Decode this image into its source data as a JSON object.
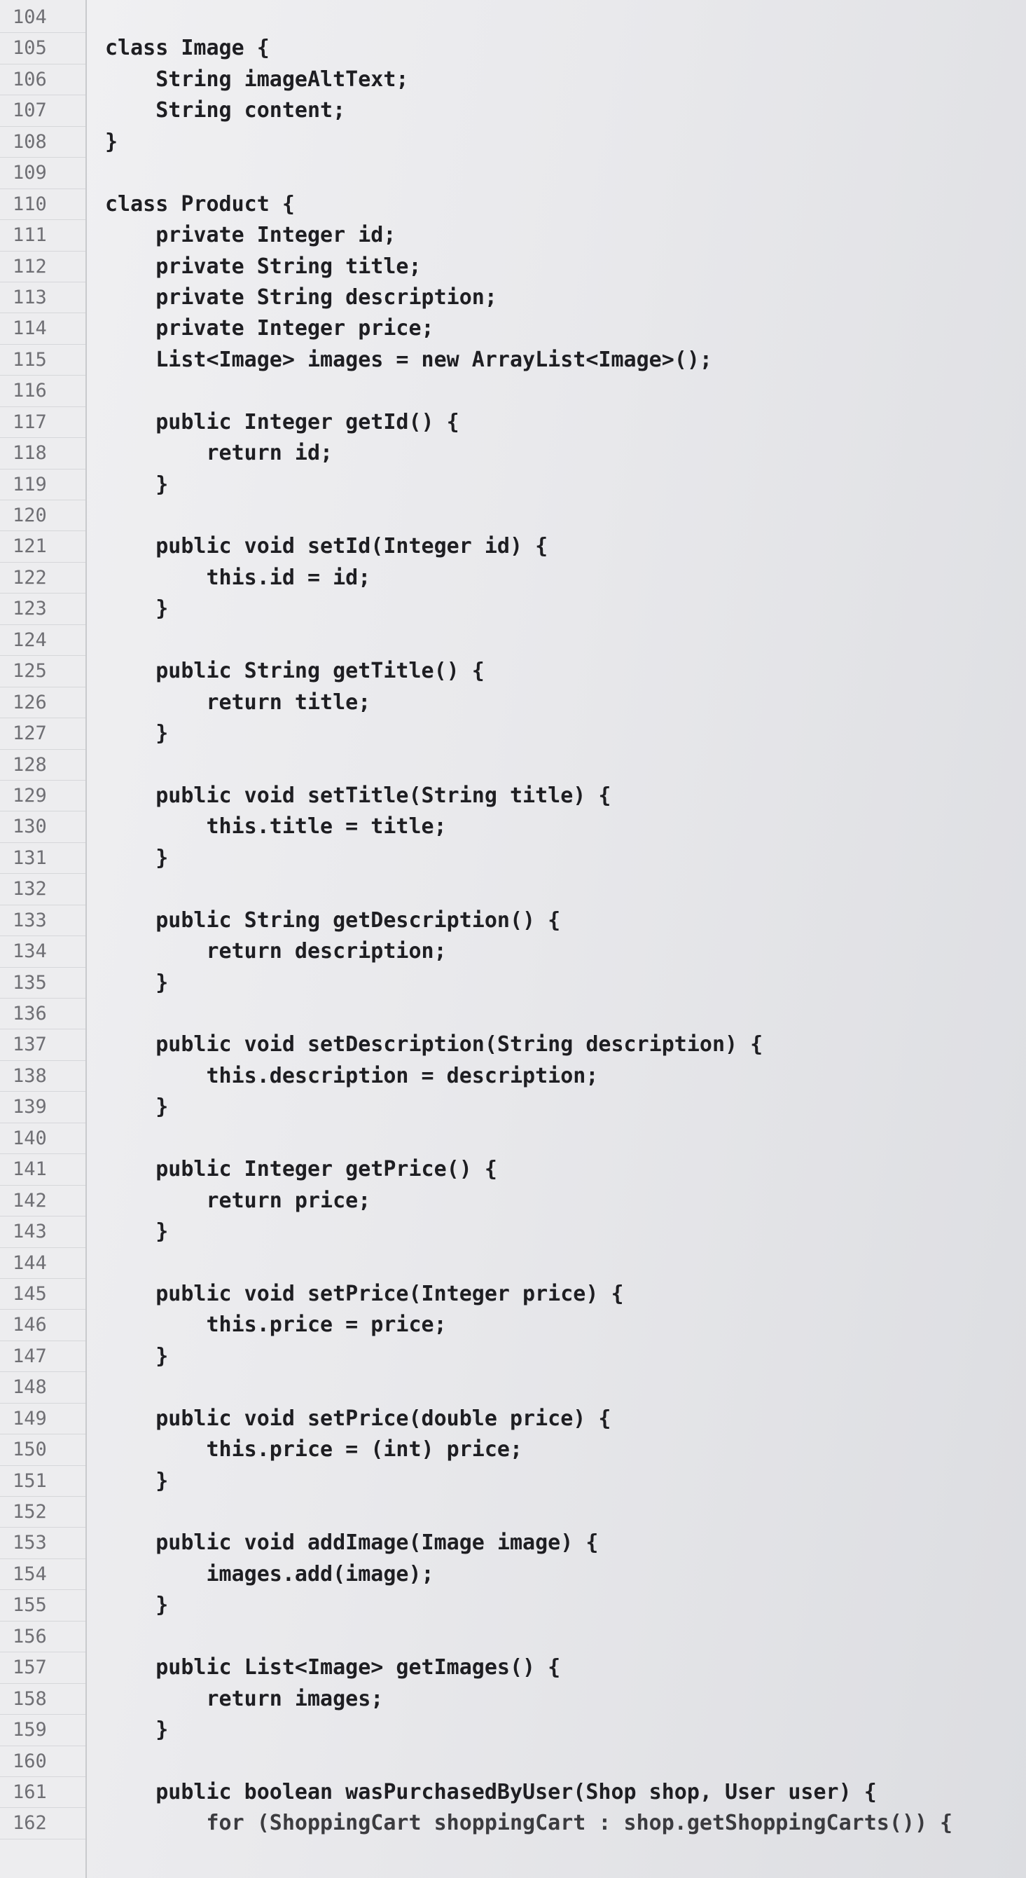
{
  "editor": {
    "lines": [
      {
        "n": "104",
        "code": ""
      },
      {
        "n": "105",
        "code": "class Image {"
      },
      {
        "n": "106",
        "code": "    String imageAltText;"
      },
      {
        "n": "107",
        "code": "    String content;"
      },
      {
        "n": "108",
        "code": "}"
      },
      {
        "n": "109",
        "code": ""
      },
      {
        "n": "110",
        "code": "class Product {"
      },
      {
        "n": "111",
        "code": "    private Integer id;"
      },
      {
        "n": "112",
        "code": "    private String title;"
      },
      {
        "n": "113",
        "code": "    private String description;"
      },
      {
        "n": "114",
        "code": "    private Integer price;"
      },
      {
        "n": "115",
        "code": "    List<Image> images = new ArrayList<Image>();"
      },
      {
        "n": "116",
        "code": ""
      },
      {
        "n": "117",
        "code": "    public Integer getId() {"
      },
      {
        "n": "118",
        "code": "        return id;"
      },
      {
        "n": "119",
        "code": "    }"
      },
      {
        "n": "120",
        "code": ""
      },
      {
        "n": "121",
        "code": "    public void setId(Integer id) {"
      },
      {
        "n": "122",
        "code": "        this.id = id;"
      },
      {
        "n": "123",
        "code": "    }"
      },
      {
        "n": "124",
        "code": ""
      },
      {
        "n": "125",
        "code": "    public String getTitle() {"
      },
      {
        "n": "126",
        "code": "        return title;"
      },
      {
        "n": "127",
        "code": "    }"
      },
      {
        "n": "128",
        "code": ""
      },
      {
        "n": "129",
        "code": "    public void setTitle(String title) {"
      },
      {
        "n": "130",
        "code": "        this.title = title;"
      },
      {
        "n": "131",
        "code": "    }"
      },
      {
        "n": "132",
        "code": ""
      },
      {
        "n": "133",
        "code": "    public String getDescription() {"
      },
      {
        "n": "134",
        "code": "        return description;"
      },
      {
        "n": "135",
        "code": "    }"
      },
      {
        "n": "136",
        "code": ""
      },
      {
        "n": "137",
        "code": "    public void setDescription(String description) {"
      },
      {
        "n": "138",
        "code": "        this.description = description;"
      },
      {
        "n": "139",
        "code": "    }"
      },
      {
        "n": "140",
        "code": ""
      },
      {
        "n": "141",
        "code": "    public Integer getPrice() {"
      },
      {
        "n": "142",
        "code": "        return price;"
      },
      {
        "n": "143",
        "code": "    }"
      },
      {
        "n": "144",
        "code": ""
      },
      {
        "n": "145",
        "code": "    public void setPrice(Integer price) {"
      },
      {
        "n": "146",
        "code": "        this.price = price;"
      },
      {
        "n": "147",
        "code": "    }"
      },
      {
        "n": "148",
        "code": ""
      },
      {
        "n": "149",
        "code": "    public void setPrice(double price) {"
      },
      {
        "n": "150",
        "code": "        this.price = (int) price;"
      },
      {
        "n": "151",
        "code": "    }"
      },
      {
        "n": "152",
        "code": ""
      },
      {
        "n": "153",
        "code": "    public void addImage(Image image) {"
      },
      {
        "n": "154",
        "code": "        images.add(image);"
      },
      {
        "n": "155",
        "code": "    }"
      },
      {
        "n": "156",
        "code": ""
      },
      {
        "n": "157",
        "code": "    public List<Image> getImages() {"
      },
      {
        "n": "158",
        "code": "        return images;"
      },
      {
        "n": "159",
        "code": "    }"
      },
      {
        "n": "160",
        "code": ""
      },
      {
        "n": "161",
        "code": "    public boolean wasPurchasedByUser(Shop shop, User user) {"
      },
      {
        "n": "162",
        "code": "        for (ShoppingCart shoppingCart : shop.getShoppingCarts()) {"
      }
    ]
  }
}
